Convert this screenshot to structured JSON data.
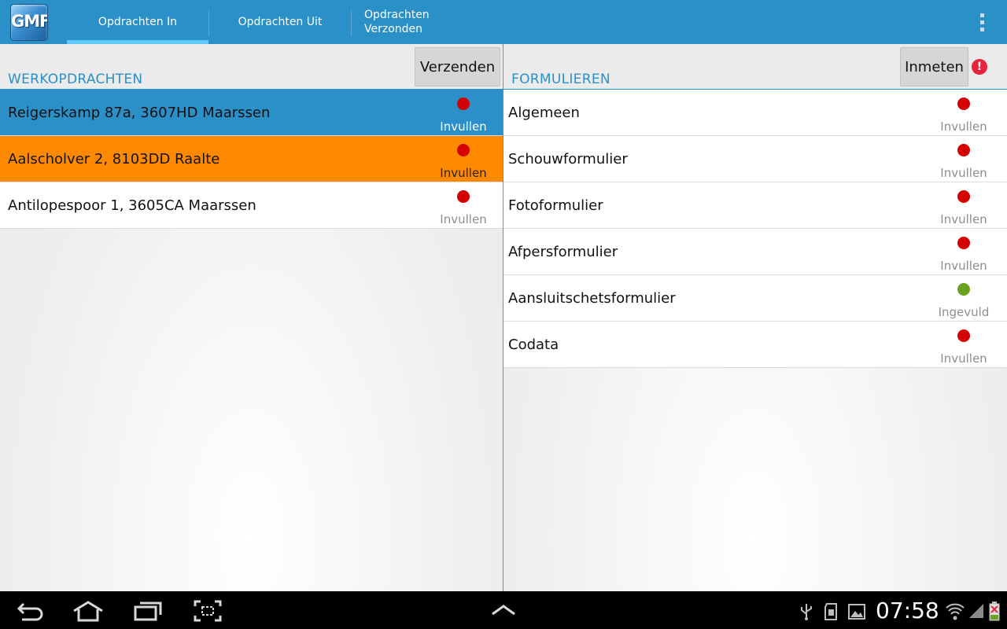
{
  "app": {
    "logo_text": "GMF"
  },
  "tabs": [
    {
      "label": "Opdrachten In"
    },
    {
      "label": "Opdrachten Uit"
    },
    {
      "label": "Opdrachten Verzonden"
    }
  ],
  "left_panel": {
    "title": "WERKOPDRACHTEN",
    "button_label": "Verzenden",
    "items": [
      {
        "name": "Reigerskamp 87a, 3607HD Maarssen",
        "status": "Invullen",
        "dot_color": "#d50000"
      },
      {
        "name": "Aalscholver 2, 8103DD Raalte",
        "status": "Invullen",
        "dot_color": "#d50000"
      },
      {
        "name": "Antilopespoor 1, 3605CA Maarssen",
        "status": "Invullen",
        "dot_color": "#d50000"
      }
    ]
  },
  "right_panel": {
    "title": "FORMULIEREN",
    "button_label": "Inmeten",
    "alert_symbol": "!",
    "items": [
      {
        "name": "Algemeen",
        "status": "Invullen",
        "dot_color": "#d50000"
      },
      {
        "name": "Schouwformulier",
        "status": "Invullen",
        "dot_color": "#d50000"
      },
      {
        "name": "Fotoformulier",
        "status": "Invullen",
        "dot_color": "#d50000"
      },
      {
        "name": "Afpersformulier",
        "status": "Invullen",
        "dot_color": "#d50000"
      },
      {
        "name": "Aansluitschetsformulier",
        "status": "Ingevuld",
        "dot_color": "#6aa321"
      },
      {
        "name": "Codata",
        "status": "Invullen",
        "dot_color": "#d50000"
      }
    ]
  },
  "colors": {
    "accent": "#2a90c7",
    "selected_row": "#2a90c7",
    "highlight_row": "#ff8a00",
    "alert": "#e8233c"
  },
  "system_bar": {
    "time": "07:58"
  }
}
